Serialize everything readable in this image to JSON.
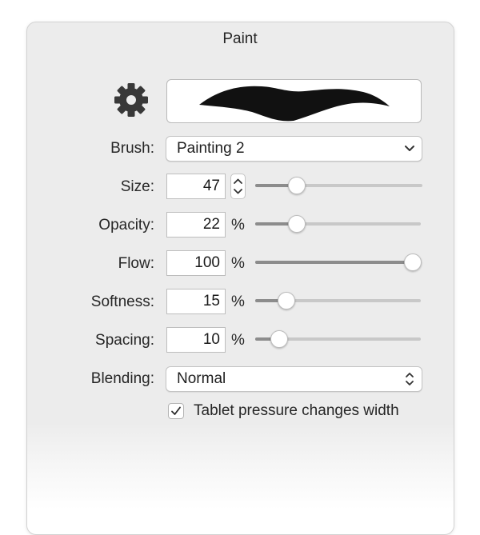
{
  "panel": {
    "title": "Paint"
  },
  "brush_preview": {
    "icon": "gear-icon",
    "stroke_color": "#111111"
  },
  "brush": {
    "label": "Brush:",
    "value": "Painting 2"
  },
  "size": {
    "label": "Size:",
    "value": "47",
    "slider_fraction": 0.22
  },
  "opacity": {
    "label": "Opacity:",
    "value": "22",
    "unit": "%",
    "slider_fraction": 0.22
  },
  "flow": {
    "label": "Flow:",
    "value": "100",
    "unit": "%",
    "slider_fraction": 1.0
  },
  "softness": {
    "label": "Softness:",
    "value": "15",
    "unit": "%",
    "slider_fraction": 0.15
  },
  "spacing": {
    "label": "Spacing:",
    "value": "10",
    "unit": "%",
    "slider_fraction": 0.1
  },
  "blending": {
    "label": "Blending:",
    "value": "Normal"
  },
  "tablet_pressure": {
    "label": "Tablet pressure changes width",
    "checked": true
  }
}
